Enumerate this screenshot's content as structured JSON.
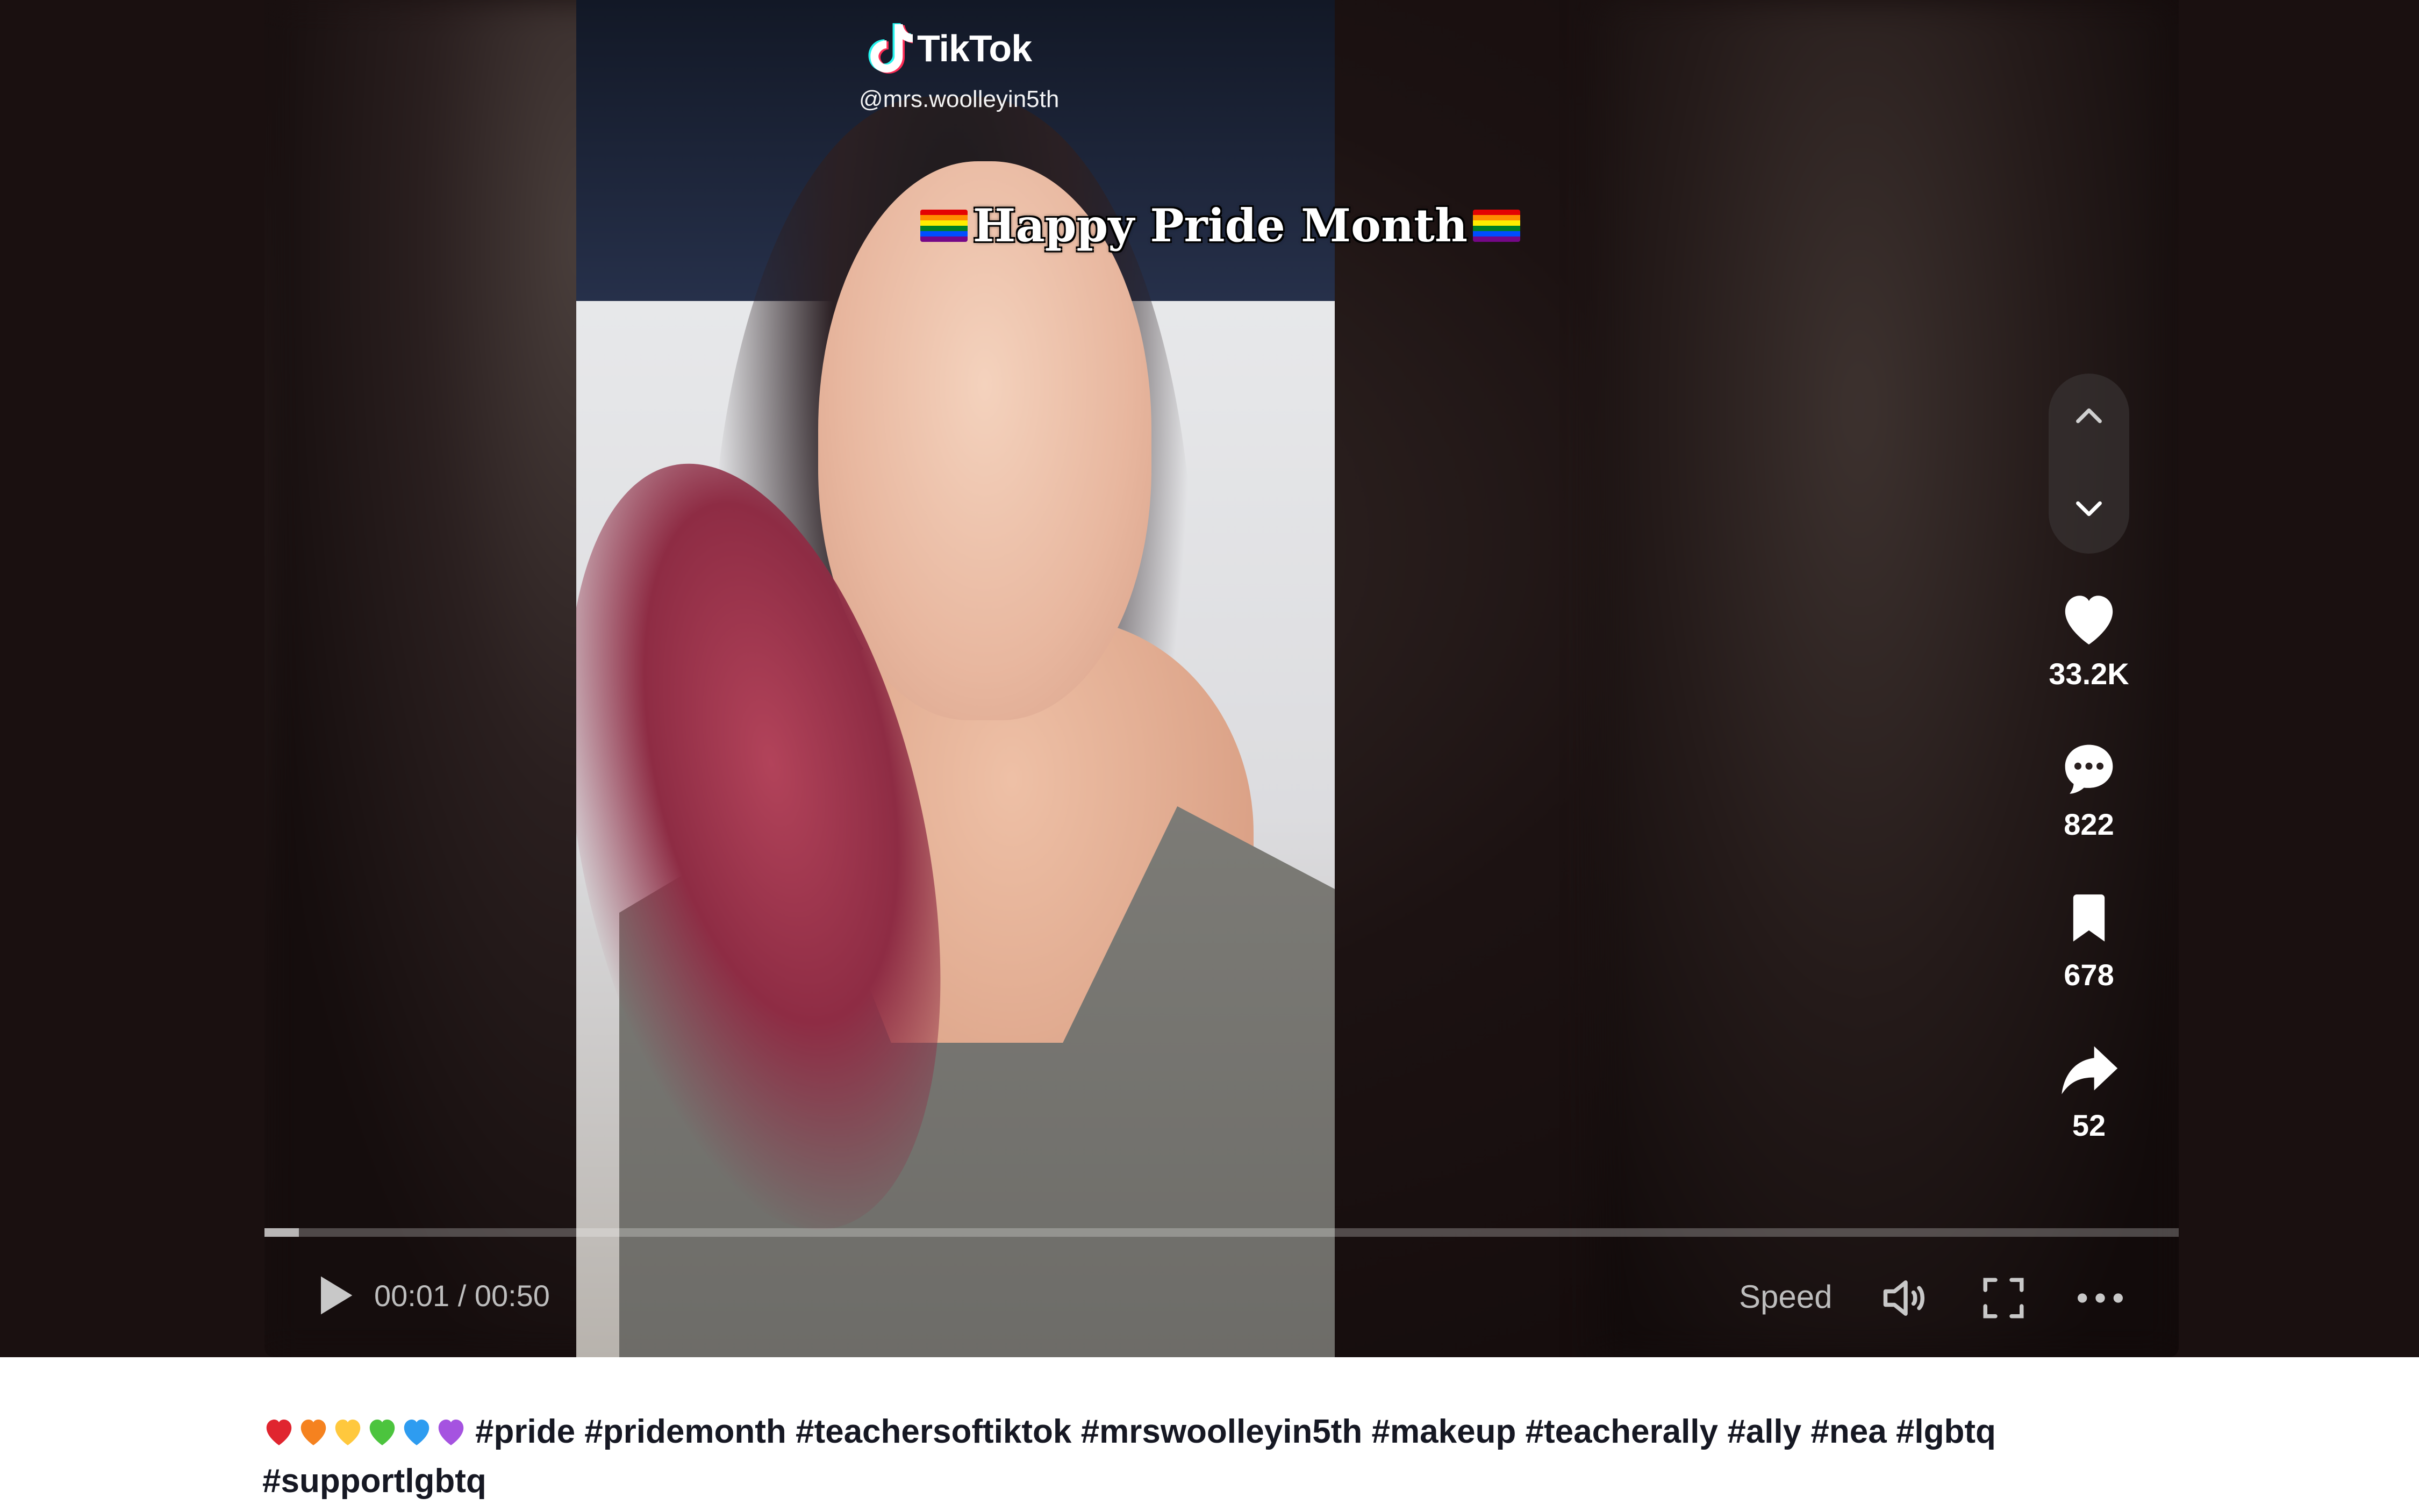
{
  "brand": {
    "name": "TikTok",
    "username": "@mrs.woolleyin5th"
  },
  "video": {
    "overlay_caption": "Happy Pride Month",
    "progress_fraction": 0.018
  },
  "navigation": {
    "previous_icon": "chevron-up-icon",
    "next_icon": "chevron-down-icon"
  },
  "actions": {
    "likes": "33.2K",
    "comments": "822",
    "saves": "678",
    "shares": "52"
  },
  "controls": {
    "time": "00:01 / 00:50",
    "speed_label": "Speed",
    "play_icon": "play-icon",
    "volume_icon": "volume-icon",
    "fullscreen_icon": "fullscreen-icon",
    "more_icon": "more-icon"
  },
  "description": {
    "hearts": [
      "#e0252f",
      "#f5821f",
      "#ffc83d",
      "#4cc43e",
      "#2e9cf0",
      "#a553e0"
    ],
    "text": "#pride #pridemonth #teachersoftiktok #mrswoolleyin5th #makeup #teacherally #ally #nea #lgbtq #supportlgbtq"
  },
  "colors": {
    "page_background": "#1a1010",
    "text_dark": "#161823",
    "control_text": "#bdbdbd"
  }
}
